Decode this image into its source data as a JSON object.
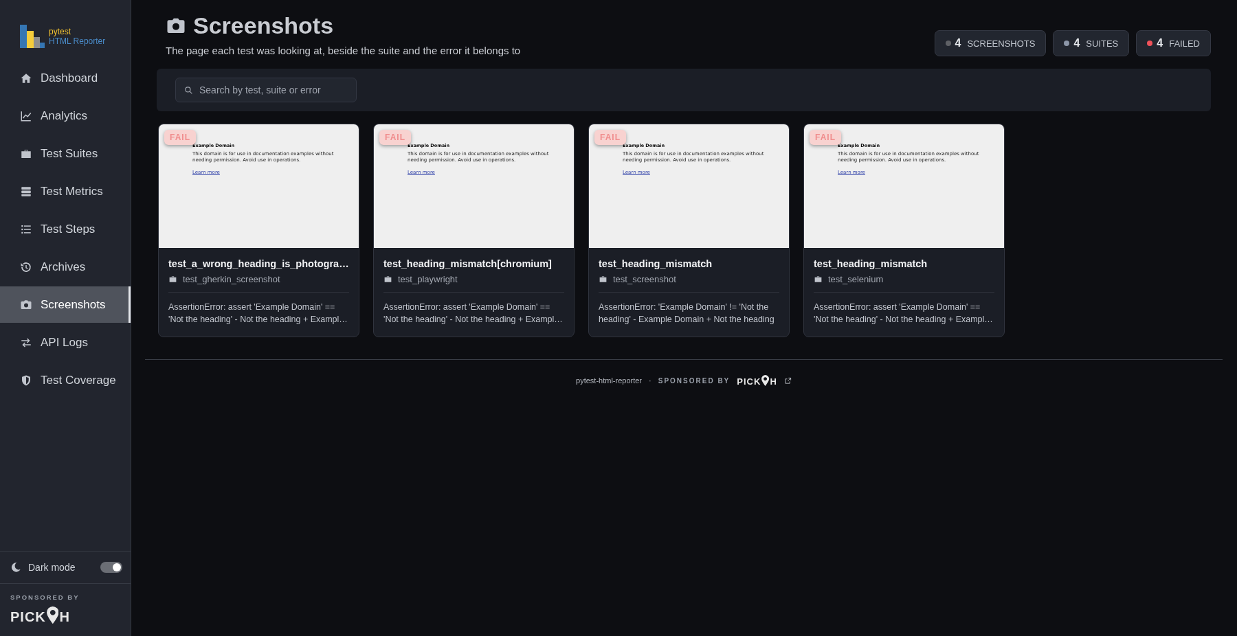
{
  "brand": {
    "line1": "pytest",
    "line2": "HTML Reporter"
  },
  "nav": [
    {
      "label": "Dashboard",
      "selected": false
    },
    {
      "label": "Analytics",
      "selected": false
    },
    {
      "label": "Test Suites",
      "selected": false
    },
    {
      "label": "Test Metrics",
      "selected": false
    },
    {
      "label": "Test Steps",
      "selected": false
    },
    {
      "label": "Archives",
      "selected": false
    },
    {
      "label": "Screenshots",
      "selected": true
    },
    {
      "label": "API Logs",
      "selected": false
    },
    {
      "label": "Test Coverage",
      "selected": false
    }
  ],
  "dark_mode": {
    "label": "Dark mode",
    "on": true
  },
  "sidebar_sponsor": {
    "label": "SPONSORED BY",
    "logo_left": "PICK",
    "logo_right": "H"
  },
  "page": {
    "title": "Screenshots",
    "subtitle": "The page each test was looking at, beside the suite and the error it belongs to"
  },
  "stats": [
    {
      "value": "4",
      "label": "SCREENSHOTS",
      "color": "#5f6166"
    },
    {
      "value": "4",
      "label": "SUITES",
      "color": "#8c96a8"
    },
    {
      "value": "4",
      "label": "FAILED",
      "color": "#f0525a"
    }
  ],
  "search": {
    "placeholder": "Search by test, suite or error"
  },
  "cards": [
    {
      "badge": "FAIL",
      "shot": {
        "heading": "Example Domain",
        "text": "This domain is for use in documentation examples without needing permission. Avoid use in operations.",
        "link": "Learn more"
      },
      "title": "test_a_wrong_heading_is_photogra…",
      "suite": "test_gherkin_screenshot",
      "error": "AssertionError: assert 'Example Domain' == 'Not the heading' - Not the heading + Exampl…"
    },
    {
      "badge": "FAIL",
      "shot": {
        "heading": "Example Domain",
        "text": "This domain is for use in documentation examples without needing permission. Avoid use in operations.",
        "link": "Learn more"
      },
      "title": "test_heading_mismatch[chromium]",
      "suite": "test_playwright",
      "error": "AssertionError: assert 'Example Domain' == 'Not the heading' - Not the heading + Exampl…"
    },
    {
      "badge": "FAIL",
      "shot": {
        "heading": "Example Domain",
        "text": "This domain is for use in documentation examples without needing permission. Avoid use in operations.",
        "link": "Learn more"
      },
      "title": "test_heading_mismatch",
      "suite": "test_screenshot",
      "error": "AssertionError: 'Example Domain' != 'Not the heading' - Example Domain + Not the heading"
    },
    {
      "badge": "FAIL",
      "shot": {
        "heading": "Example Domain",
        "text": "This domain is for use in documentation examples without needing permission. Avoid use in operations.",
        "link": "Learn more"
      },
      "title": "test_heading_mismatch",
      "suite": "test_selenium",
      "error": "AssertionError: assert 'Example Domain' == 'Not the heading' - Not the heading + Exampl…"
    }
  ],
  "footer": {
    "project": "pytest-html-reporter",
    "separator": "·",
    "sponsored": "SPONSORED BY",
    "logo_left": "PICK",
    "logo_right": "H"
  }
}
